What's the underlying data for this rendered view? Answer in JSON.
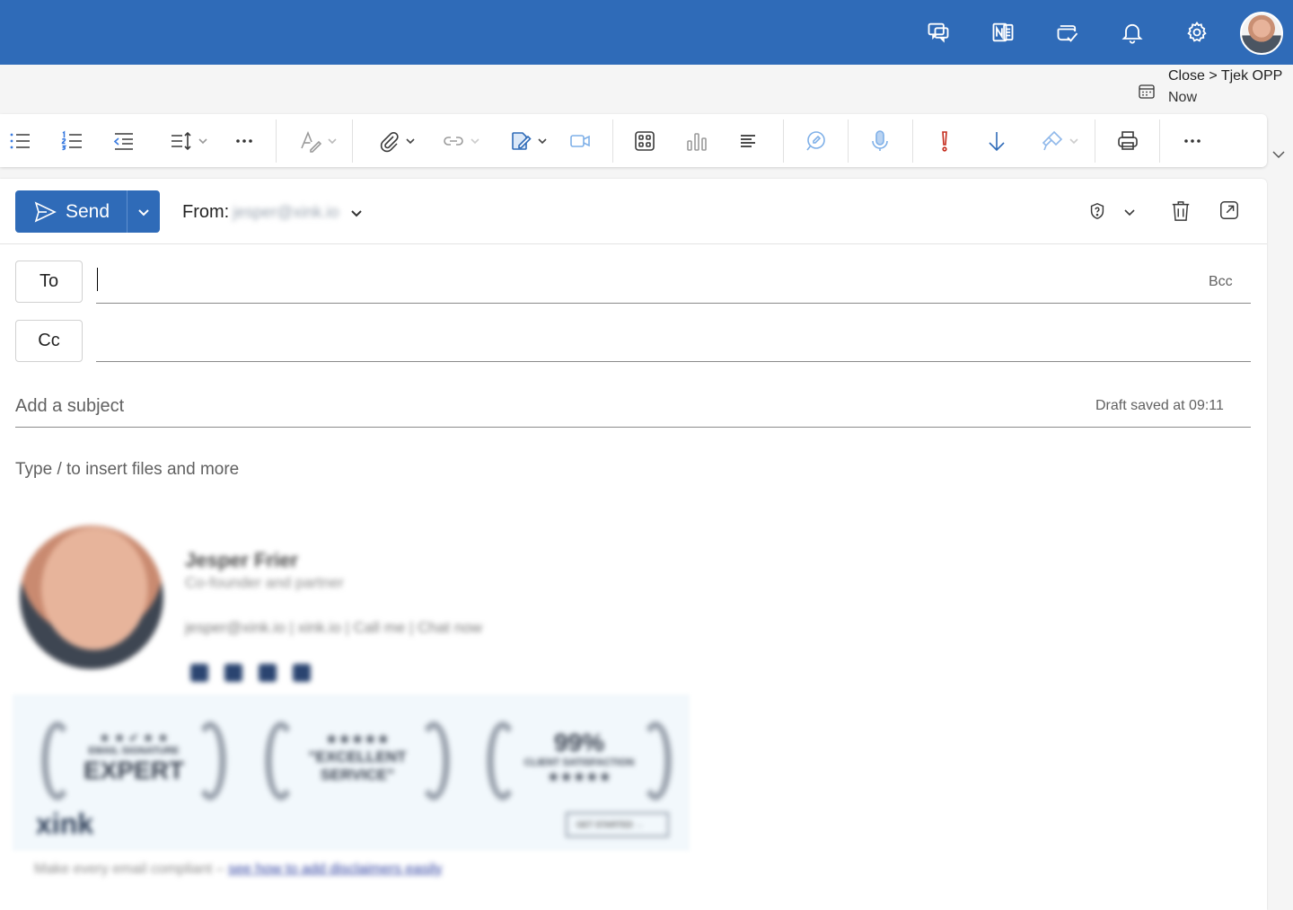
{
  "topbar": {
    "icons": [
      "teams-chat-icon",
      "onenote-icon",
      "todo-icon",
      "bell-icon",
      "settings-gear-icon",
      "user-avatar"
    ],
    "accent": "#2f6bb8"
  },
  "reminder": {
    "title": "Close > Tjek OPP",
    "time": "Now"
  },
  "ribbon": {
    "icons": [
      "bulleted-list-icon",
      "numbered-list-icon",
      "decrease-indent-icon",
      "line-spacing-icon",
      "more-icon",
      "text-style-icon",
      "attach-icon",
      "link-icon",
      "signature-icon",
      "video-icon",
      "apps-icon",
      "chart-icon",
      "align-icon",
      "loop-icon",
      "dictate-icon",
      "high-importance-icon",
      "low-importance-icon",
      "format-painter-icon",
      "print-icon",
      "more-icon"
    ]
  },
  "compose": {
    "send_label": "Send",
    "from_label": "From:",
    "from_address": "jesper@xink.io",
    "to_label": "To",
    "cc_label": "Cc",
    "bcc_label": "Bcc",
    "subject_placeholder": "Add a subject",
    "draft_status": "Draft saved at 09:11",
    "body_hint": "Type / to insert files and more"
  },
  "signature": {
    "name": "Jesper Frier",
    "role": "Co-founder and partner",
    "contact": "jesper@xink.io | xink.io | Call me | Chat now",
    "badges": [
      {
        "top": "★ ★ ✔ ★ ★",
        "small": "EMAIL SIGNATURE",
        "big": "EXPERT"
      },
      {
        "top": "★★★★★",
        "small": "",
        "big": "\"EXCELLENT SERVICE\""
      },
      {
        "top": "99%",
        "small": "CLIENT SATISFACTION",
        "big": "★★★★★"
      }
    ],
    "logo": "xink",
    "cta": "GET STARTED →",
    "footer_text": "Make every email compliant – ",
    "footer_link": "see how to add disclaimers easily"
  }
}
